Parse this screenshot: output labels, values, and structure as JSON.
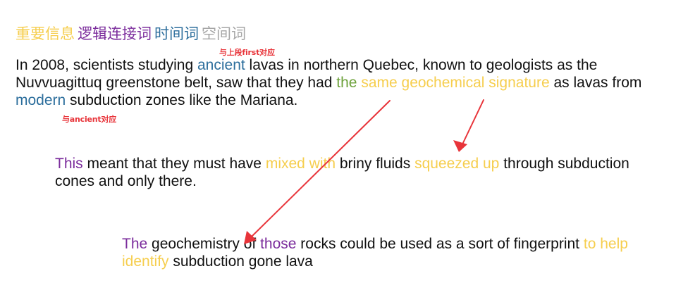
{
  "legend": {
    "important": "重要信息",
    "logic": "逻辑连接词",
    "time": "时间词",
    "space": "空间词"
  },
  "colors": {
    "important": "#f6ce4e",
    "logic": "#7b2c9c",
    "time": "#2c6e9c",
    "space": "#a6a6a6",
    "article": "#6ca13a",
    "annotation": "#e8343a"
  },
  "annotations": {
    "note_first": "与上段first对应",
    "note_ancient": "与ancient对应"
  },
  "paragraph1": {
    "s1": "In 2008, scientists studying ",
    "ancient": "ancient",
    "s2": " lavas in northern Quebec, known to geologists as the Nuvvuagittuq greenstone belt, saw that they had ",
    "the": "the",
    "signature": " same geochemical signature",
    "s3": " as lavas from ",
    "modern": "modern",
    "s4": " subduction zones like the Mariana."
  },
  "paragraph2": {
    "this": "This",
    "s1": " meant that they must have ",
    "mixed": "mixed with",
    "s2": " briny fluids ",
    "squeezed": "squeezed up",
    "s3": " through subduction cones and only there."
  },
  "paragraph3": {
    "the": "The",
    "s1": " geochemistry of ",
    "those": "those",
    "s2": " rocks could be used as a sort of fingerprint ",
    "help": "to help identify",
    "s3": " subduction gone lava"
  }
}
